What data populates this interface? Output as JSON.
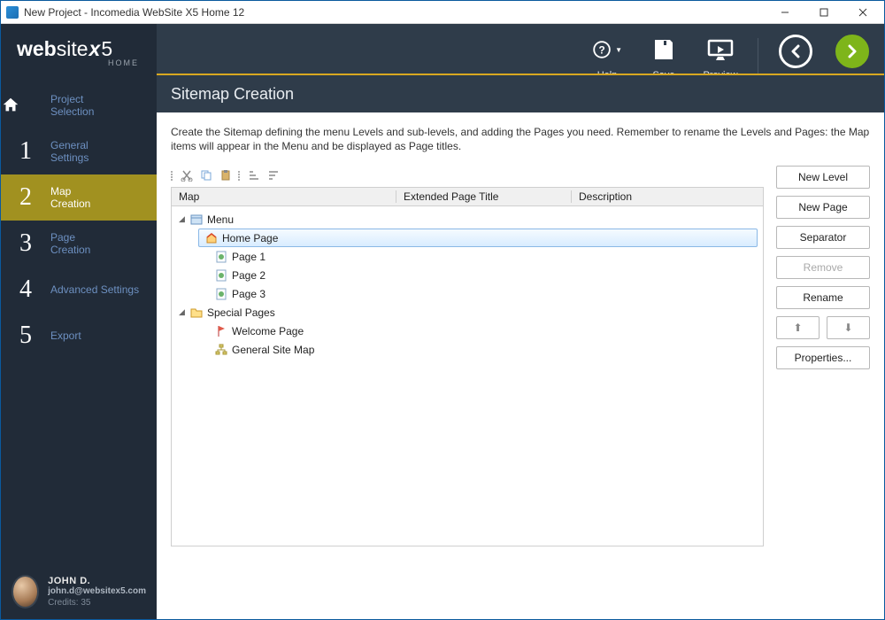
{
  "window": {
    "title": "New Project - Incomedia WebSite X5 Home 12"
  },
  "logo": {
    "main_a": "web",
    "main_b": "site",
    "x": "x",
    "five": "5",
    "sub": "HOME"
  },
  "sidebar": {
    "items": [
      {
        "num": "",
        "label": "Project\nSelection",
        "icon": "house"
      },
      {
        "num": "1",
        "label": "General\nSettings"
      },
      {
        "num": "2",
        "label": "Map\nCreation"
      },
      {
        "num": "3",
        "label": "Page\nCreation"
      },
      {
        "num": "4",
        "label": "Advanced Settings"
      },
      {
        "num": "5",
        "label": "Export"
      }
    ],
    "active_index": 2
  },
  "user": {
    "name": "JOHN D.",
    "email": "john.d@websitex5.com",
    "credits": "Credits: 35"
  },
  "topbar": {
    "help": "Help",
    "save": "Save",
    "preview": "Preview",
    "back": "Back",
    "next": "Next"
  },
  "page_header": "Sitemap Creation",
  "instruction": "Create the Sitemap defining the menu Levels and sub-levels, and adding the Pages you need. Remember to rename the Levels and Pages: the Map items will appear in the Menu and be displayed as Page titles.",
  "grid": {
    "col_map": "Map",
    "col_ext": "Extended Page Title",
    "col_desc": "Description"
  },
  "tree": {
    "menu_label": "Menu",
    "home_label": "Home Page",
    "page1": "Page 1",
    "page2": "Page 2",
    "page3": "Page 3",
    "special_label": "Special Pages",
    "welcome_label": "Welcome Page",
    "gsm_label": "General Site Map"
  },
  "buttons": {
    "new_level": "New Level",
    "new_page": "New Page",
    "separator": "Separator",
    "remove": "Remove",
    "rename": "Rename",
    "up": "⬆",
    "down": "⬇",
    "properties": "Properties..."
  }
}
